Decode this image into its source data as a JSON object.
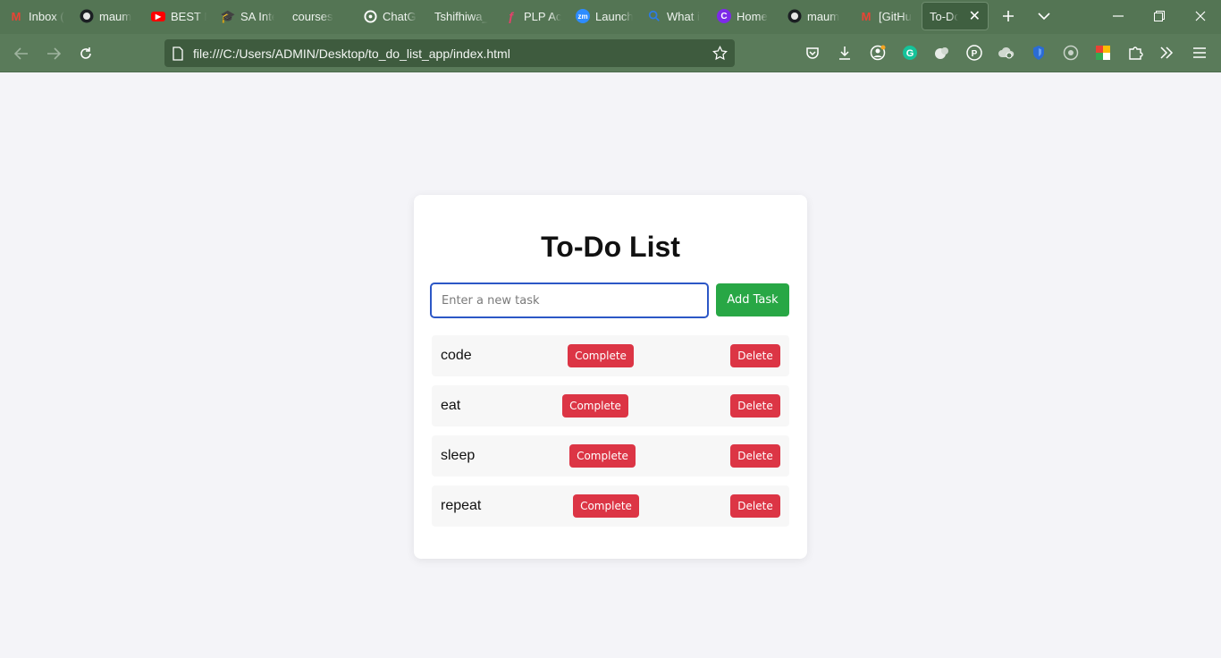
{
  "browser": {
    "tabs": [
      {
        "label": "Inbox (",
        "icon": "gmail-icon"
      },
      {
        "label": "maum",
        "icon": "github-icon"
      },
      {
        "label": "BEST M",
        "icon": "youtube-icon"
      },
      {
        "label": "SA Inte",
        "icon": "graduation-cap-icon"
      },
      {
        "label": "courses",
        "icon": ""
      },
      {
        "label": "ChatG",
        "icon": "chatgpt-icon"
      },
      {
        "label": "Tshifhiwa_",
        "icon": ""
      },
      {
        "label": "PLP Ac",
        "icon": "plp-icon"
      },
      {
        "label": "Launch",
        "icon": "zoom-icon"
      },
      {
        "label": "What i",
        "icon": "search-icon"
      },
      {
        "label": "Home",
        "icon": "canva-icon"
      },
      {
        "label": "maum",
        "icon": "github-icon"
      },
      {
        "label": "[GitHu",
        "icon": "gmail-icon"
      }
    ],
    "active_tab": {
      "label": "To-Do Li"
    },
    "url": "file:///C:/Users/ADMIN/Desktop/to_do_list_app/index.html"
  },
  "app": {
    "title": "To-Do List",
    "input": {
      "placeholder": "Enter a new task",
      "value": ""
    },
    "add_label": "Add Task",
    "complete_label": "Complete",
    "delete_label": "Delete",
    "tasks": [
      {
        "name": "code"
      },
      {
        "name": "eat"
      },
      {
        "name": "sleep"
      },
      {
        "name": "repeat"
      }
    ]
  },
  "colors": {
    "chrome": "#547554",
    "add_button": "#28a745",
    "action_button": "#dc3545",
    "input_border": "#2c57c6"
  }
}
